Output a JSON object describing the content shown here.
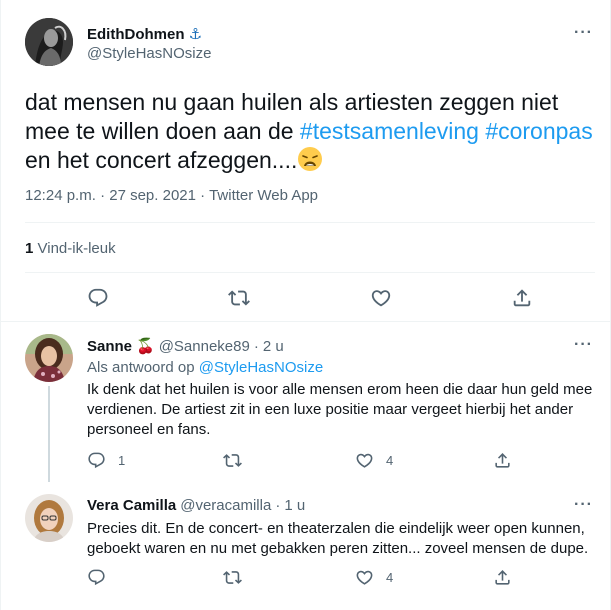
{
  "main_tweet": {
    "author_name": "EdithDohmen",
    "author_emoji": "⚓",
    "author_handle": "@StyleHasNOsize",
    "more_label": "···",
    "text_part1": "dat mensen nu gaan huilen als artiesten zeggen niet mee te willen doen aan de ",
    "hashtag1": "#testsamenleving",
    "text_space": " ",
    "hashtag2": "#coronpas",
    "text_part2": " en het concert afzeggen....",
    "time": "12:24 p.m.",
    "date": "27 sep. 2021",
    "separator": "·",
    "client": "Twitter Web App",
    "like_count": "1",
    "like_label": "Vind-ik-leuk"
  },
  "replies": [
    {
      "name": "Sanne",
      "name_emoji": "🍒",
      "handle": "@Sanneke89",
      "sep": "·",
      "time": "2 u",
      "reply_to_label": "Als antwoord op",
      "reply_to_handle": "@StyleHasNOsize",
      "text": "Ik denk dat het huilen is voor alle mensen erom heen die daar hun geld mee verdienen. De artiest zit in een luxe positie maar vergeet hierbij het ander personeel en fans.",
      "reply_count": "1",
      "retweet_count": "",
      "like_count": "4",
      "more_label": "···"
    },
    {
      "name": "Vera Camilla",
      "handle": "@veracamilla",
      "sep": "·",
      "time": "1 u",
      "text": "Precies dit. En de concert- en theaterzalen die eindelijk weer open kunnen, geboekt waren en nu met gebakken peren zitten... zoveel mensen de dupe.",
      "reply_count": "",
      "retweet_count": "",
      "like_count": "4",
      "more_label": "···"
    }
  ],
  "icons": {
    "reply": "reply-icon",
    "retweet": "retweet-icon",
    "like": "heart-icon",
    "share": "share-icon",
    "more": "more-icon",
    "anchor": "anchor-emoji",
    "cherry": "cherry-emoji",
    "weary": "weary-face-emoji"
  },
  "colors": {
    "text": "#0f1419",
    "secondary": "#536471",
    "link": "#1d9bf0",
    "border": "#eff3f4"
  }
}
